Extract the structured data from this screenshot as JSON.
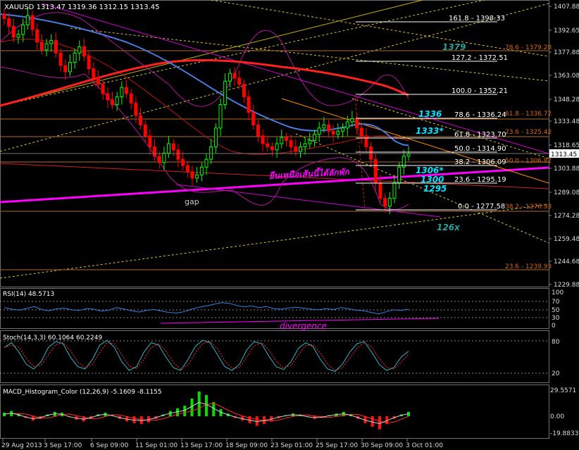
{
  "header": {
    "symbol_text": "XAUUSD",
    "ohlc_text": "1313.47 1319.36 1312.15 1313.45"
  },
  "current_price_label": "1313.45",
  "price_axis_ticks": [
    "1407.88",
    "1392.65",
    "1377.88",
    "1363.08",
    "1348.28",
    "1333.48",
    "1318.65",
    "1303.88",
    "1289.08",
    "1274.28",
    "1259.48",
    "1244.68",
    "1229.88"
  ],
  "time_axis_labels": [
    "29 Aug 2013",
    "3 Sep 17:00",
    "6 Sep 09:00",
    "11 Sep 01:00",
    "13 Sep 17:00",
    "18 Sep 09:00",
    "23 Sep 01:00",
    "25 Sep 17:00",
    "30 Sep 09:00",
    "3 Oct 01:00"
  ],
  "fib_upper": [
    {
      "text": "161.8 - 1398.33"
    },
    {
      "text": "127.2 - 1372.51"
    },
    {
      "text": "100.0 - 1352.21"
    },
    {
      "text": "78.6 - 1336.24"
    },
    {
      "text": "61.8 - 1323.70"
    },
    {
      "text": "50.0 - 1314.90"
    },
    {
      "text": "38.2 - 1306.09"
    },
    {
      "text": "23.6 - 1295.19"
    },
    {
      "text": "0.0 - 1277.58"
    }
  ],
  "fib_lower": [
    {
      "text": "78.6 - 1379.28"
    },
    {
      "text": "61.8 - 1336.72"
    },
    {
      "text": "23.6 - 1325.42"
    },
    {
      "text": "50.0 - 1306.82"
    },
    {
      "text": "38.2 - 1276.93"
    },
    {
      "text": "23.6 - 1239.93"
    }
  ],
  "annotations": {
    "a1379": "1379",
    "a1336": "1336",
    "a1333": "1333*",
    "a1306": "1306*",
    "a1300": "1300",
    "a1295": "1295",
    "a126x": "126x",
    "gap": "gap",
    "thai_note": "ยืนเหนือเส้นนี้ได้ลักพัก",
    "divergence": "divergence"
  },
  "rsi": {
    "title": "RSI(14) 48.5713",
    "ticks": [
      "100",
      "70",
      "50",
      "30",
      "0"
    ]
  },
  "stoch": {
    "title": "Stoch(14,3,3) 60.1064 60.2249",
    "ticks": [
      "80",
      "20"
    ]
  },
  "macd": {
    "title": "MACD_Histogram_Color (12,26,9) -5.1609 -8.1155",
    "ticks": [
      "29.5571",
      "0.00",
      "-19.8833"
    ]
  },
  "colors": {
    "background": "#000000",
    "bull_candle": "#00ff00",
    "bear_candle": "#ff0000",
    "fib_text": "#ffffff",
    "fib_text_lower": "#d2691e",
    "annotation_cyan": "#00e5ff",
    "annotation_teal": "#2aa198",
    "magenta": "#ff00ff",
    "ma_red": "#ff2020",
    "ma_blue": "#4a7bdc"
  },
  "chart_data": {
    "type": "candlestick",
    "timeframe": "H4",
    "close": [
      1400,
      1395,
      1388,
      1390,
      1396,
      1402,
      1393,
      1385,
      1380,
      1384,
      1386,
      1378,
      1370,
      1366,
      1372,
      1378,
      1382,
      1376,
      1368,
      1362,
      1358,
      1352,
      1348,
      1345,
      1350,
      1356,
      1352,
      1346,
      1338,
      1332,
      1325,
      1318,
      1312,
      1308,
      1314,
      1320,
      1316,
      1310,
      1306,
      1302,
      1298,
      1300,
      1305,
      1310,
      1318,
      1330,
      1345,
      1360,
      1365,
      1362,
      1358,
      1350,
      1340,
      1332,
      1325,
      1320,
      1318,
      1316,
      1320,
      1324,
      1322,
      1318,
      1315,
      1318,
      1320,
      1322,
      1326,
      1330,
      1332,
      1328,
      1326,
      1328,
      1330,
      1334,
      1336,
      1330,
      1325,
      1318,
      1310,
      1295,
      1285,
      1280,
      1285,
      1295,
      1305,
      1312,
      1313.45
    ],
    "current_price": 1313.45
  }
}
